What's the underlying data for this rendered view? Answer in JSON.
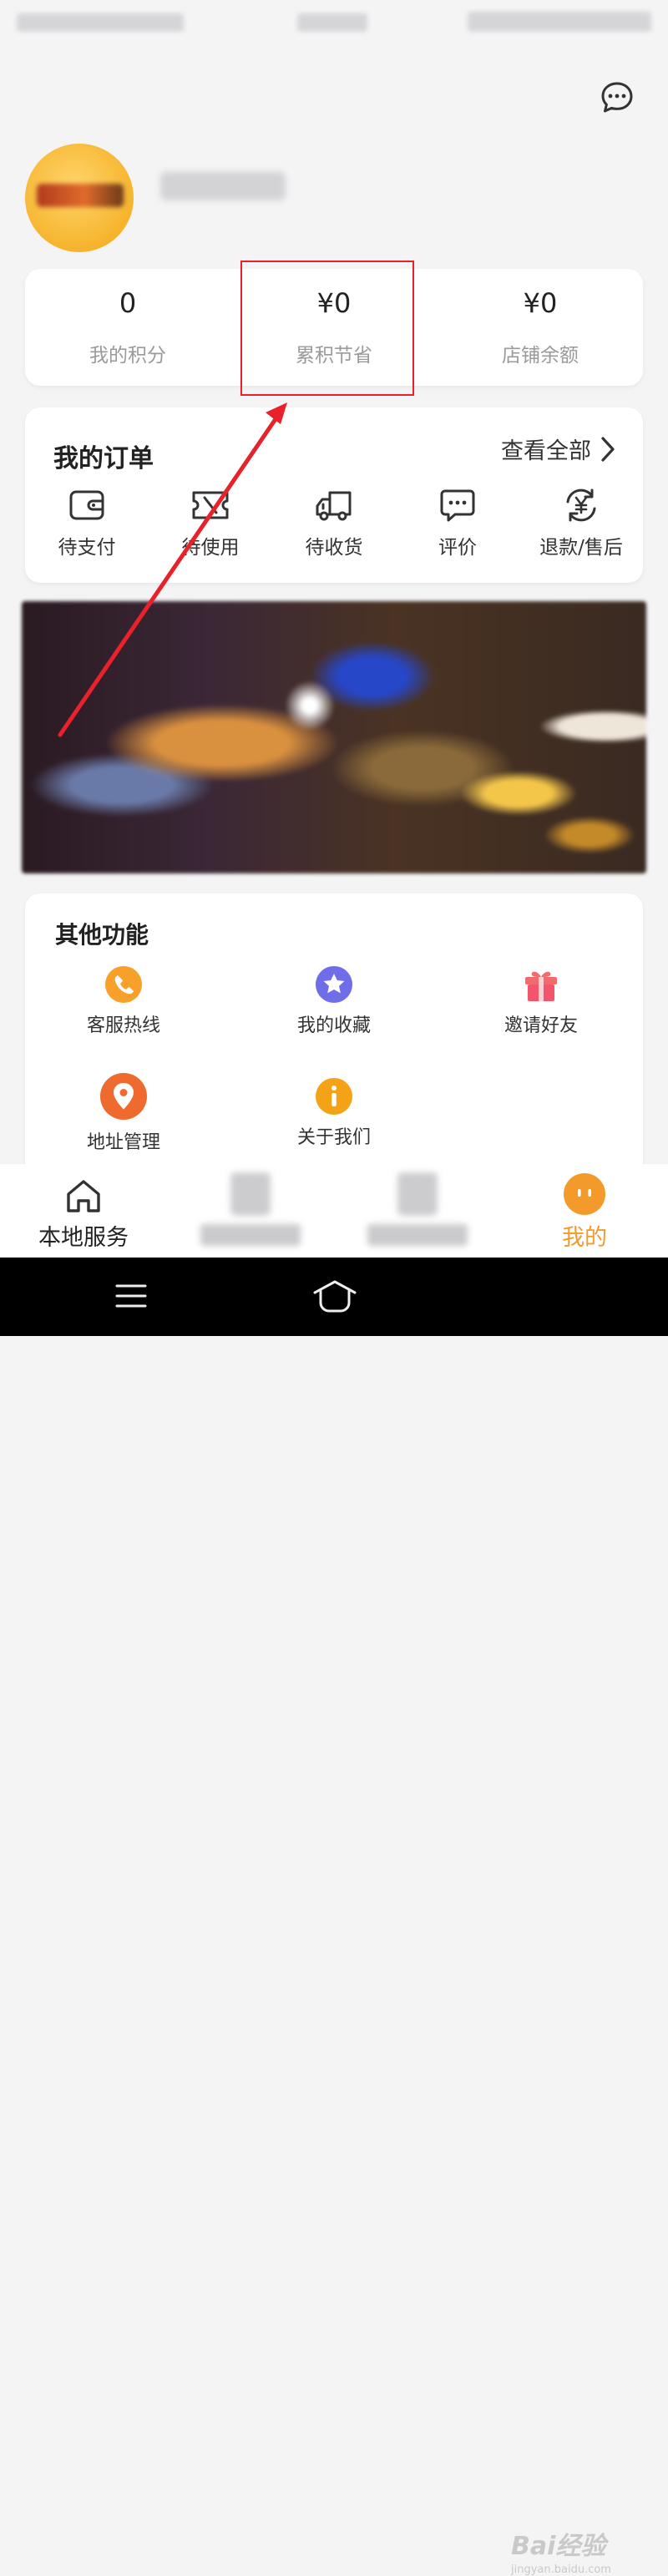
{
  "stats": [
    {
      "value": "0",
      "label": "我的积分"
    },
    {
      "value": "¥0",
      "label": "累积节省"
    },
    {
      "value": "¥0",
      "label": "店铺余额"
    }
  ],
  "orders": {
    "title": "我的订单",
    "view_all": "查看全部",
    "items": [
      {
        "label": "待支付",
        "icon": "wallet-icon"
      },
      {
        "label": "待使用",
        "icon": "ticket-icon"
      },
      {
        "label": "待收货",
        "icon": "truck-icon"
      },
      {
        "label": "评价",
        "icon": "comment-icon"
      },
      {
        "label": "退款/售后",
        "icon": "refund-icon"
      }
    ]
  },
  "other": {
    "title": "其他功能",
    "items": [
      {
        "label": "客服热线",
        "icon": "phone-icon",
        "color": "#f7a12b"
      },
      {
        "label": "我的收藏",
        "icon": "star-icon",
        "color": "#6f6ee8"
      },
      {
        "label": "邀请好友",
        "icon": "gift-icon",
        "color": "#f0505e"
      },
      {
        "label": "地址管理",
        "icon": "location-icon",
        "color": "#ee6a2f"
      },
      {
        "label": "关于我们",
        "icon": "info-icon",
        "color": "#f5a316"
      }
    ]
  },
  "tabbar": {
    "items": [
      {
        "label": "本地服务",
        "icon": "home-icon"
      },
      {
        "label": "",
        "icon": "blurred-icon"
      },
      {
        "label": "",
        "icon": "blurred-icon"
      },
      {
        "label": "我的",
        "icon": "profile-face-icon"
      }
    ],
    "active_color": "#f39a2a"
  },
  "watermark": {
    "brand": "Bai经验",
    "url": "jingyan.baidu.com"
  },
  "colors": {
    "accent": "#f39a2a",
    "annotation": "#e8222a",
    "background": "#f4f4f5"
  }
}
